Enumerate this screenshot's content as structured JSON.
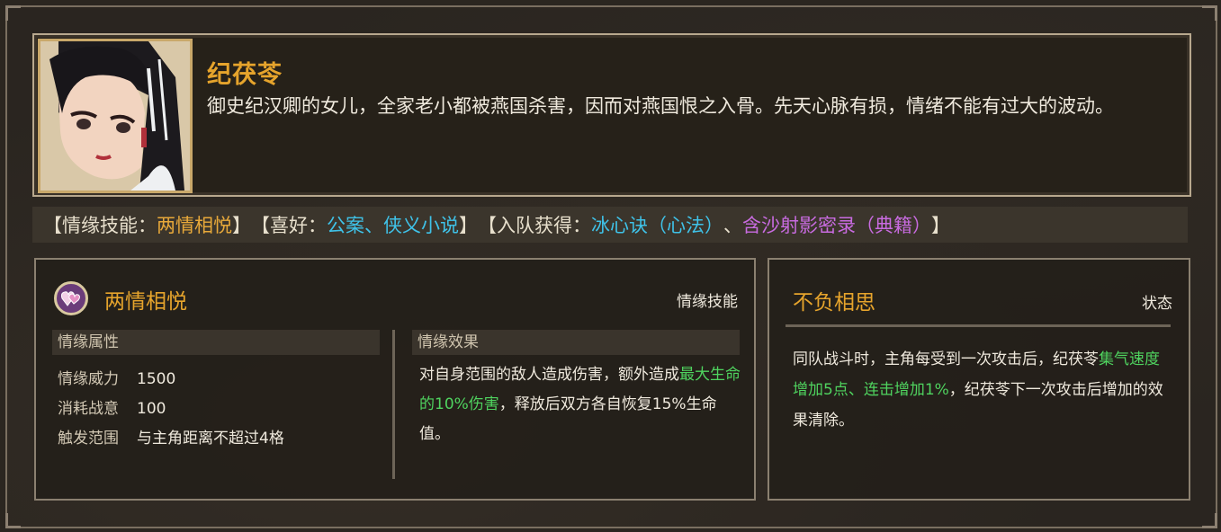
{
  "character": {
    "name": "纪茯苓",
    "description": "御史纪汉卿的女儿，全家老小都被燕国杀害，因而对燕国恨之入骨。先天心脉有损，情绪不能有过大的波动。"
  },
  "tagline": {
    "bond_skill_prefix": "【情缘技能：",
    "bond_skill_name": "两情相悦",
    "bond_skill_suffix": "】",
    "likes_prefix": "【喜好：",
    "likes_value": "公案、侠义小说",
    "likes_suffix": "】",
    "join_prefix": "【入队获得：",
    "join_item1": "冰心诀（心法）",
    "join_sep": "、",
    "join_item2": "含沙射影密录（典籍）",
    "join_suffix": "】"
  },
  "skill_panel": {
    "icon": "double-heart-icon",
    "title": "两情相悦",
    "tag": "情缘技能",
    "attributes_header": "情缘属性",
    "attributes": [
      {
        "label": "情缘威力",
        "value": "1500"
      },
      {
        "label": "消耗战意",
        "value": "100"
      },
      {
        "label": "触发范围",
        "value": "与主角距离不超过4格"
      }
    ],
    "effect_header": "情缘效果",
    "effect_part1": "对自身范围的敌人造成伤害，额外造成",
    "effect_highlight": "最大生命的10%伤害",
    "effect_part2": "，释放后双方各自恢复15%生命值。"
  },
  "status_panel": {
    "title": "不负相思",
    "tag": "状态",
    "text_part1": "同队战斗时，主角每受到一次攻击后，纪茯苓",
    "text_highlight": "集气速度增加5点、连击增加1%",
    "text_part2": "，纪茯苓下一次攻击后增加的效果清除。"
  },
  "colors": {
    "gold": "#e6a42c",
    "blue": "#3fc2e8",
    "purple": "#c86be0",
    "green": "#4fd35f"
  }
}
